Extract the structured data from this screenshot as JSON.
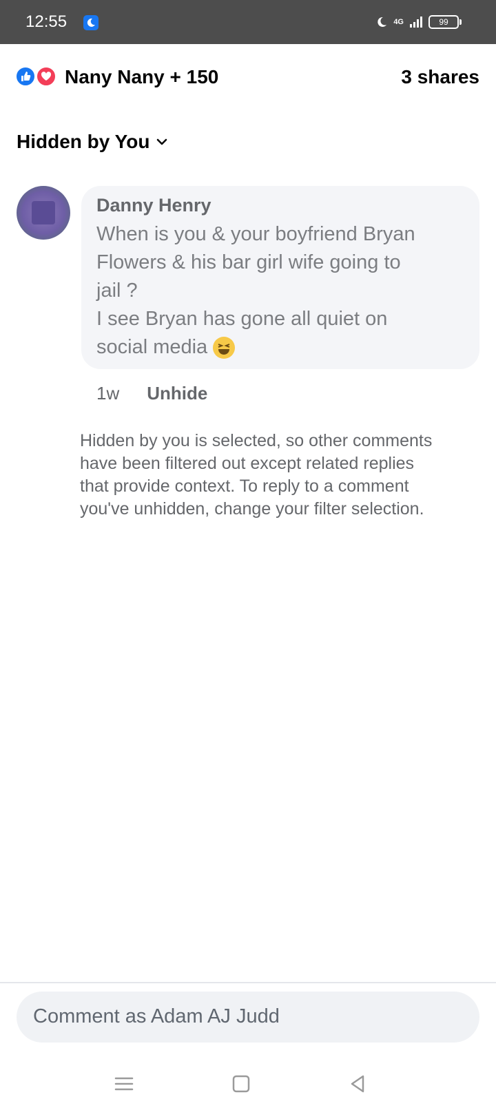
{
  "status_bar": {
    "time": "12:55",
    "network": "4G",
    "battery": "99"
  },
  "post": {
    "reactions_text": "Nany Nany + 150",
    "shares": "3 shares",
    "reaction_icons": [
      "like-icon",
      "love-icon"
    ]
  },
  "filter": {
    "label": "Hidden by You"
  },
  "comment": {
    "author": "Danny Henry",
    "line1": "When is you & your boyfriend Bryan",
    "line2": "Flowers & his bar girl wife going to",
    "line3": "jail ?",
    "line4": "I see Bryan has gone all quiet on",
    "line5": "social media",
    "time": "1w",
    "unhide_label": "Unhide"
  },
  "info": {
    "text": "Hidden by you is selected, so other comments have been filtered out except related replies that provide context. To reply to a comment you've unhidden, change your filter selection."
  },
  "composer": {
    "placeholder": "Comment as Adam AJ Judd"
  },
  "nav": {
    "icons": [
      "menu-icon",
      "home-icon",
      "back-icon"
    ]
  },
  "colors": {
    "like": "#1877f2",
    "love": "#f33e58",
    "status_bar": "#4d4d4d"
  }
}
